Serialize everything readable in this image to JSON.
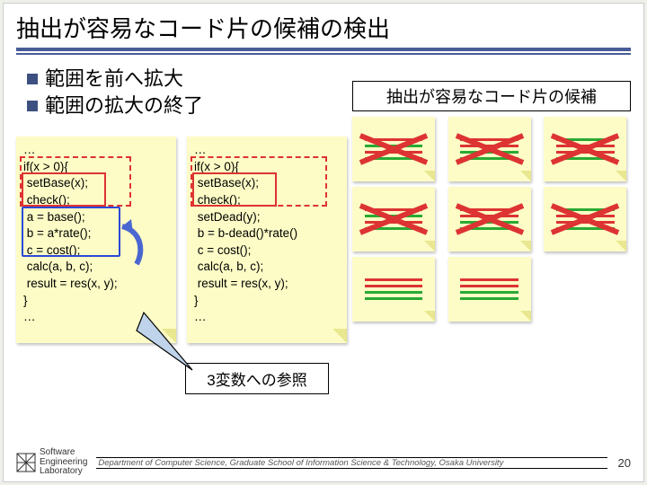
{
  "title": "抽出が容易なコード片の候補の検出",
  "bullets": [
    "範囲を前へ拡大",
    "範囲の拡大の終了"
  ],
  "code_left": [
    "…",
    "if(x > 0){",
    " setBase(x);",
    " check();",
    " a = base();",
    " b = a*rate();",
    " c = cost();",
    " calc(a, b, c);",
    " result = res(x, y);",
    "}",
    "…"
  ],
  "code_right": [
    "…",
    "if(x > 0){",
    " setBase(x);",
    " check();",
    " setDead(y);",
    " b = b-dead()*rate()",
    " c = cost();",
    " calc(a, b, c);",
    " result = res(x, y);",
    "}",
    "…"
  ],
  "candidates_title": "抽出が容易なコード片の候補",
  "candidates": [
    {
      "pattern": [
        "red",
        "green",
        "red",
        "green"
      ],
      "crossed": true
    },
    {
      "pattern": [
        "red",
        "red",
        "green",
        "green"
      ],
      "crossed": true
    },
    {
      "pattern": [
        "green",
        "red",
        "red",
        "green"
      ],
      "crossed": true
    },
    {
      "pattern": [
        "red",
        "green",
        "red",
        "green"
      ],
      "crossed": true
    },
    {
      "pattern": [
        "red",
        "red",
        "green",
        "green"
      ],
      "crossed": true
    },
    {
      "pattern": [
        "green",
        "red",
        "red",
        "green"
      ],
      "crossed": true
    },
    {
      "pattern": [
        "red",
        "red",
        "green",
        "green"
      ],
      "crossed": false
    },
    {
      "pattern": [
        "red",
        "red",
        "green",
        "green"
      ],
      "crossed": false
    }
  ],
  "callout_text": "3変数への参照",
  "footer": {
    "logo_lines": [
      "Software",
      "Engineering",
      "Laboratory"
    ],
    "department": "Department of Computer Science, Graduate School of Information Science & Technology, Osaka University",
    "page": "20"
  }
}
